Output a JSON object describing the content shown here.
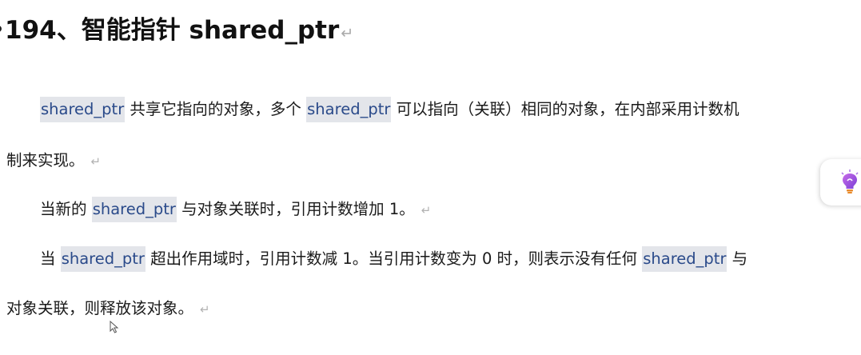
{
  "document": {
    "heading": "194、智能指针 shared_ptr",
    "paragraph_mark": "↵",
    "paragraphs": [
      {
        "line1": {
          "code1": "shared_ptr",
          "text1": " 共享它指向的对象，多个 ",
          "code2": "shared_ptr",
          "text2": " 可以指向（关联）相同的对象，在内部采用计数机"
        },
        "line2": {
          "text": "制来实现。"
        }
      },
      {
        "line1": {
          "text1": "当新的 ",
          "code1": "shared_ptr",
          "text2": " 与对象关联时，引用计数增加 1。"
        }
      },
      {
        "line1": {
          "text1": "当 ",
          "code1": "shared_ptr",
          "text2": " 超出作用域时，引用计数减 1。当引用计数变为 0 时，则表示没有任何 ",
          "code2": "shared_ptr",
          "text3": " 与"
        },
        "line2": {
          "text": "对象关联，则释放该对象。"
        }
      }
    ]
  },
  "side_panel": {
    "icon": "lightbulb-assistant-icon"
  },
  "cursor": {
    "icon": "mouse-pointer-icon"
  }
}
